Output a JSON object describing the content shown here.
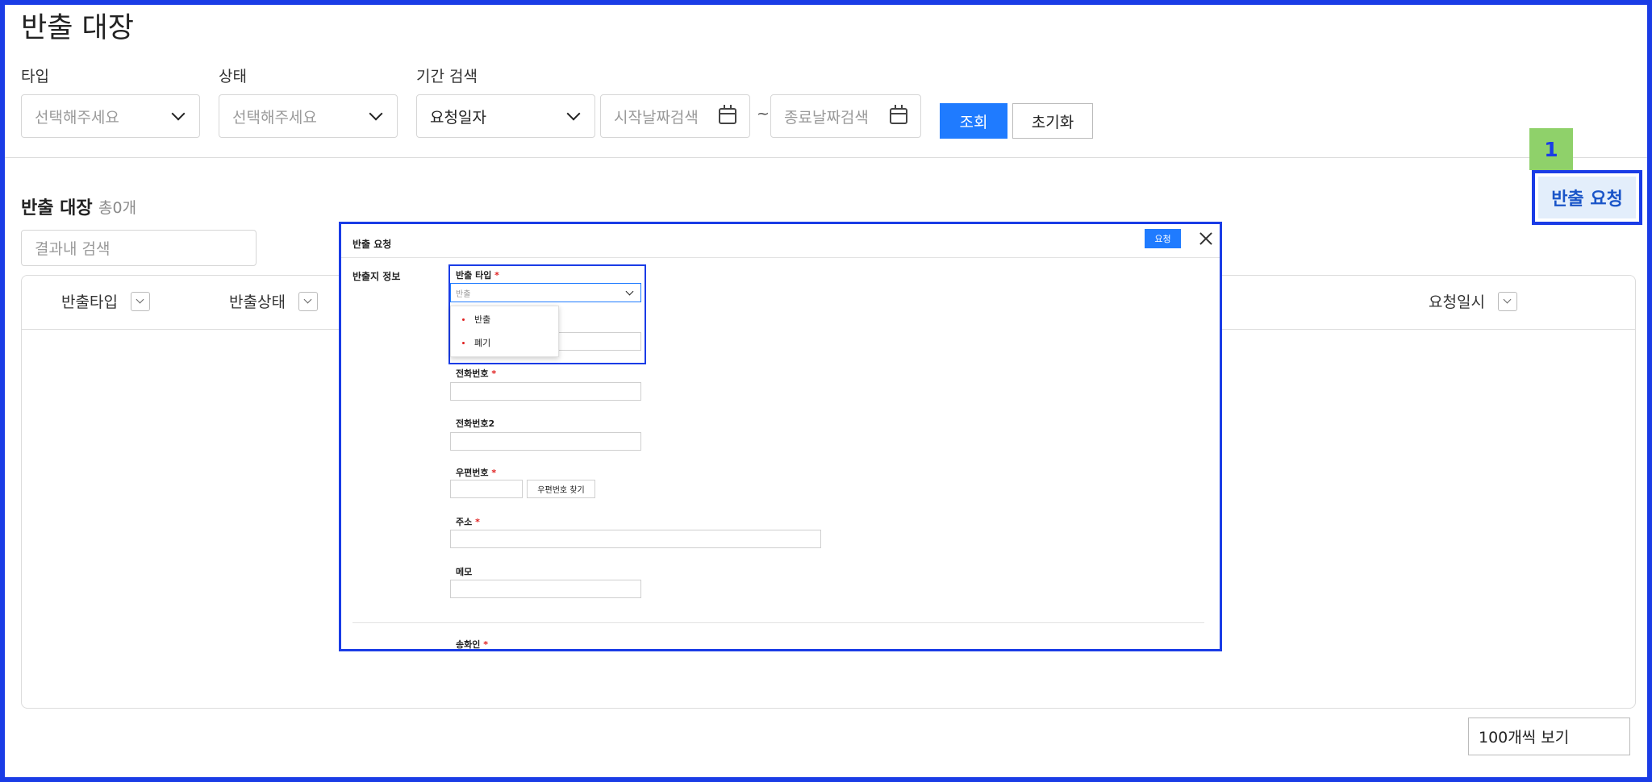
{
  "page": {
    "title": "반출 대장"
  },
  "filters": {
    "type": {
      "label": "타입",
      "placeholder": "선택해주세요"
    },
    "status": {
      "label": "상태",
      "placeholder": "선택해주세요"
    },
    "period": {
      "label": "기간 검색",
      "basis_value": "요청일자",
      "start_placeholder": "시작날짜검색",
      "separator": "~",
      "end_placeholder": "종료날짜검색"
    },
    "search_button": "조회",
    "reset_button": "초기화"
  },
  "annotation": {
    "badge": "1"
  },
  "request_button": "반출 요청",
  "list": {
    "title": "반출 대장",
    "count": "총0개",
    "search_placeholder": "결과내 검색",
    "columns": [
      "반출타입",
      "반출상태",
      "요청일시"
    ],
    "per_page": "100개씩 보기"
  },
  "modal": {
    "title": "반출 요청",
    "submit": "요청",
    "section_label": "반출지 정보",
    "fields": {
      "type_label": "반출 타입",
      "type_value": "반출",
      "phone_label": "전화번호",
      "phone2_label": "전화번호2",
      "zip_label": "우편번호",
      "zip_button": "우편번호 찾기",
      "address_label": "주소",
      "memo_label": "메모",
      "sender_label": "송화인"
    },
    "required_mark": "*",
    "dropdown_options": [
      "반출",
      "폐기"
    ]
  },
  "colors": {
    "accent": "#1f7bff",
    "highlight": "#1a3ce6",
    "badge": "#8fd16a",
    "required": "#e02020"
  }
}
